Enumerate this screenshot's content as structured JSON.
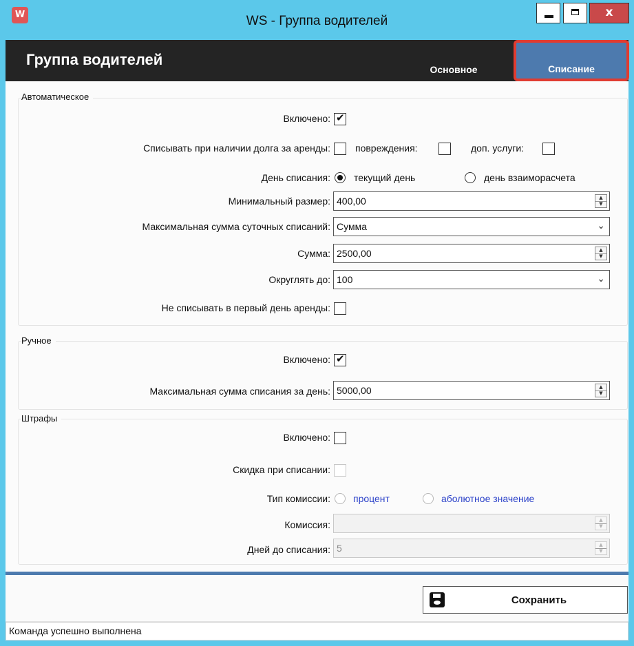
{
  "window": {
    "title": "WS - Группа водителей",
    "icon_letter": "W",
    "controls": [
      "minimize",
      "maximize",
      "close"
    ],
    "close_glyph": "x",
    "icon": "app-icon"
  },
  "header": {
    "title": "Группа водителей",
    "tabs": [
      {
        "label": "Основное",
        "active": false
      },
      {
        "label": "Списание",
        "active": true
      }
    ]
  },
  "auto": {
    "title": "Автоматическое",
    "enabled_label": "Включено:",
    "enabled": true,
    "debt_label": "Списывать при наличии долга за аренды:",
    "debt_rent": false,
    "damage_label": "повреждения:",
    "debt_damage": false,
    "services_label": "доп. услуги:",
    "debt_services": false,
    "day_label": "День списания:",
    "day_options": [
      {
        "label": "текущий день",
        "selected": true
      },
      {
        "label": "день взаиморасчета",
        "selected": false
      }
    ],
    "min_label": "Минимальный размер:",
    "min_value": "400,00",
    "max_daily_label": "Максимальная сумма суточных списаний:",
    "max_daily_value": "Сумма",
    "sum_label": "Сумма:",
    "sum_value": "2500,00",
    "round_label": "Округлять до:",
    "round_value": "100",
    "no_first_day_label": "Не списывать в первый день аренды:",
    "no_first_day": false
  },
  "manual": {
    "title": "Ручное",
    "enabled_label": "Включено:",
    "enabled": true,
    "max_label": "Максимальная сумма списания за день:",
    "max_value": "5000,00"
  },
  "fines": {
    "title": "Штрафы",
    "enabled_label": "Включено:",
    "enabled": false,
    "discount_label": "Скидка при списании:",
    "discount": false,
    "type_label": "Тип комиссии:",
    "type_options": [
      {
        "label": "процент",
        "selected": false
      },
      {
        "label": "аболютное значение",
        "selected": false
      }
    ],
    "commission_label": "Комиссия:",
    "commission_value": "",
    "days_label": "Дней до списания:",
    "days_value": "5"
  },
  "footer": {
    "save_label": "Сохранить",
    "save_icon": "floppy-disk-icon",
    "status": "Команда успешно выполнена"
  },
  "colors": {
    "titlebar": "#5bc8ea",
    "header": "#242424",
    "active_tab": "#4d7aae",
    "highlight": "#e03c31",
    "disabled_link": "#2d43c9"
  }
}
